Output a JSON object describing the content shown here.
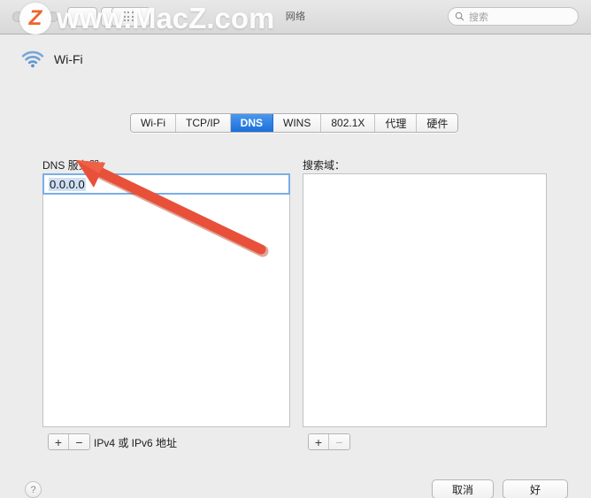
{
  "window": {
    "title": "网络",
    "traffic_lights": [
      "close",
      "minimize",
      "zoom"
    ],
    "nav": {
      "back_label": "‹",
      "forward_label": "›",
      "showall_icon": "grid-icon"
    },
    "search": {
      "placeholder": "搜索",
      "value": "",
      "icon": "search-icon"
    }
  },
  "service": {
    "icon": "wifi-icon",
    "name": "Wi-Fi"
  },
  "tabs": [
    {
      "id": "wifi",
      "label": "Wi-Fi",
      "active": false
    },
    {
      "id": "tcpip",
      "label": "TCP/IP",
      "active": false
    },
    {
      "id": "dns",
      "label": "DNS",
      "active": true
    },
    {
      "id": "wins",
      "label": "WINS",
      "active": false
    },
    {
      "id": "8021x",
      "label": "802.1X",
      "active": false
    },
    {
      "id": "proxy",
      "label": "代理",
      "active": false
    },
    {
      "id": "hw",
      "label": "硬件",
      "active": false
    }
  ],
  "dns_panel": {
    "servers_label": "DNS 服务器：",
    "servers": [
      {
        "value": "0.0.0.0",
        "selected": true,
        "editing": true
      }
    ],
    "servers_add_label": "+",
    "servers_remove_label": "−",
    "servers_remove_disabled": false,
    "servers_hint": "IPv4 或 IPv6 地址",
    "search_domains_label": "搜索域：",
    "search_domains": [],
    "domains_add_label": "+",
    "domains_remove_label": "−",
    "domains_remove_disabled": true
  },
  "footer": {
    "help_label": "?",
    "cancel_label": "取消",
    "ok_label": "好"
  },
  "watermark": {
    "badge_letter": "Z",
    "text": "www.MacZ.com"
  },
  "annotation": {
    "type": "red-arrow",
    "points_to": "dns-server-entry",
    "color": "#e8503a"
  },
  "colors": {
    "accent_blue": "#1b6fd9",
    "tab_active_top": "#4b97ee",
    "focus_border": "#7aaee8",
    "selection_bg": "#cfe0f5",
    "window_bg": "#ececec",
    "arrow_red": "#e8503a",
    "watermark_orange": "#f0632a"
  }
}
